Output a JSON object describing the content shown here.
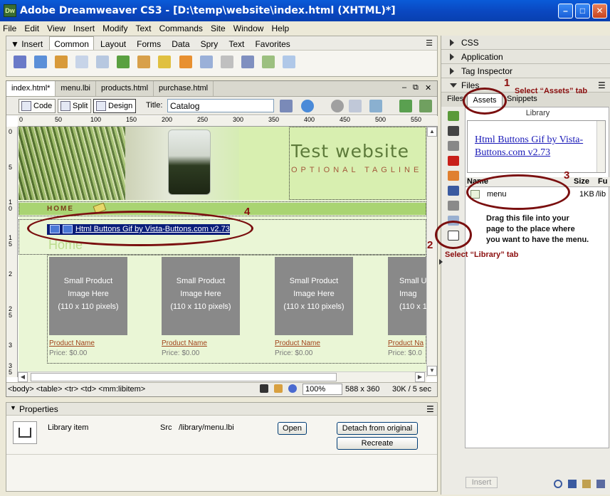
{
  "window": {
    "logo": "Dw",
    "title": "Adobe Dreamweaver CS3 - [D:\\temp\\website\\index.html (XHTML)*]",
    "min": "–",
    "max": "□",
    "close": "✕"
  },
  "menubar": [
    "File",
    "Edit",
    "View",
    "Insert",
    "Modify",
    "Text",
    "Commands",
    "Site",
    "Window",
    "Help"
  ],
  "insert_panel": {
    "label": "Insert",
    "tabs": [
      "Common",
      "Layout",
      "Forms",
      "Data",
      "Spry",
      "Text",
      "Favorites"
    ],
    "active_tab": "Common"
  },
  "document": {
    "tabs": [
      "index.html*",
      "menu.lbi",
      "products.html",
      "purchase.html"
    ],
    "views": {
      "code": "Code",
      "split": "Split",
      "design": "Design"
    },
    "title_label": "Title:",
    "title_value": "Catalog",
    "ruler_ticks": [
      "0",
      "50",
      "100",
      "150",
      "200",
      "250",
      "300",
      "350",
      "400",
      "450",
      "500",
      "550"
    ],
    "ruler_left": [
      "0",
      "5",
      "1 0",
      "1 5",
      "2",
      "2 5",
      "3",
      "3 5"
    ]
  },
  "page": {
    "site_title": "Test website",
    "tagline": "OPTIONAL TAGLINE",
    "nav_home": "HOME",
    "library_item_text": "Html Buttons Gif by Vista-Buttons.com v2.73",
    "heading": "Home",
    "products": [
      {
        "box_line1": "Small Product",
        "box_line2": "Image Here",
        "box_line3": "(110 x 110 pixels)",
        "name": "Product Name",
        "price": "Price: $0.00"
      },
      {
        "box_line1": "Small Product",
        "box_line2": "Image Here",
        "box_line3": "(110 x 110 pixels)",
        "name": "Product Name",
        "price": "Price: $0.00"
      },
      {
        "box_line1": "Small Product",
        "box_line2": "Image Here",
        "box_line3": "(110 x 110 pixels)",
        "name": "Product Name",
        "price": "Price: $0.00"
      },
      {
        "box_line1": "Small U",
        "box_line2": "Imag",
        "box_line3": "(110 x 11",
        "name": "Product Na",
        "price": "Price: $0.0"
      }
    ]
  },
  "statusbar": {
    "tags": "<body> <table> <tr> <td> <mm:libitem>",
    "zoom": "100%",
    "size": "588 x 360",
    "download": "30K / 5 sec"
  },
  "properties": {
    "header": "Properties",
    "item_label": "Library item",
    "src_label": "Src",
    "src_value": "/library/menu.lbi",
    "open_button": "Open",
    "detach_button": "Detach from original",
    "recreate_button": "Recreate"
  },
  "right_panel": {
    "groups": [
      "CSS",
      "Application",
      "Tag Inspector",
      "Files"
    ],
    "files_tabs": [
      "Files",
      "Assets",
      "Snippets"
    ],
    "library_label": "Library",
    "preview_text": "Html Buttons Gif by Vista-Buttons.com v2.73",
    "col_name": "Name",
    "col_size": "Size",
    "col_full": "Fu",
    "item_name": "menu",
    "item_size": "1KB",
    "item_path": "/lib",
    "insert_button": "Insert"
  },
  "annotations": {
    "n1": "1",
    "t1": "Select “Assets” tab",
    "n2": "2",
    "t2": "Select “Library” tab",
    "n3": "3",
    "t3_line1": "Drag this file into your",
    "t3_line2": "page to the place where",
    "t3_line3": "you want to have the menu.",
    "n4": "4"
  },
  "colors": {
    "titlebar": "#0a47c0",
    "annotation": "#8b0d0d",
    "nav_bar": "#a9d472",
    "header_bg": "#d8efb0"
  }
}
